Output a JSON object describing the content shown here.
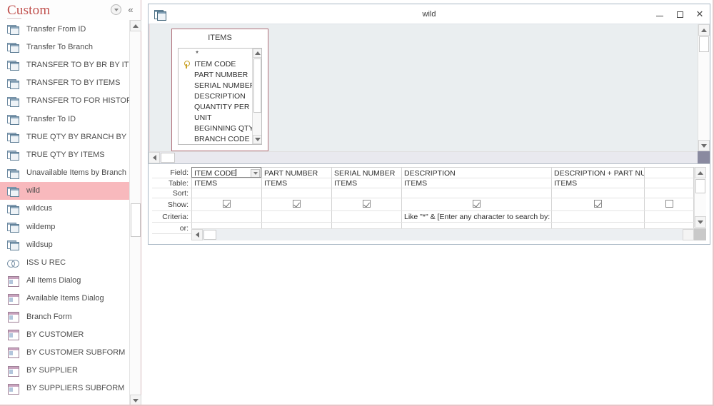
{
  "nav_pane": {
    "title": "Custom",
    "dropdown_icon": "chevron-down-circle-icon",
    "collapse_icon": "double-chevron-left-icon",
    "items": [
      {
        "label": "Transfer From ID",
        "icon": "query-icon",
        "type": "query",
        "selected": false
      },
      {
        "label": "Transfer To Branch",
        "icon": "query-icon",
        "type": "query",
        "selected": false
      },
      {
        "label": "TRANSFER TO BY BR BY ITEMS",
        "icon": "query-icon",
        "type": "query",
        "selected": false
      },
      {
        "label": "TRANSFER TO BY ITEMS",
        "icon": "query-icon",
        "type": "query",
        "selected": false
      },
      {
        "label": "TRANSFER TO FOR HISTORY",
        "icon": "query-icon",
        "type": "query",
        "selected": false
      },
      {
        "label": "Transfer To ID",
        "icon": "query-icon",
        "type": "query",
        "selected": false
      },
      {
        "label": "TRUE QTY BY BRANCH BY ITEM",
        "icon": "query-icon",
        "type": "query",
        "selected": false
      },
      {
        "label": "TRUE QTY BY ITEMS",
        "icon": "query-icon",
        "type": "query",
        "selected": false
      },
      {
        "label": "Unavailable Items by Branch",
        "icon": "query-icon",
        "type": "query",
        "selected": false
      },
      {
        "label": "wild",
        "icon": "query-icon",
        "type": "query",
        "selected": true
      },
      {
        "label": "wildcus",
        "icon": "query-icon",
        "type": "query",
        "selected": false
      },
      {
        "label": "wildemp",
        "icon": "query-icon",
        "type": "query",
        "selected": false
      },
      {
        "label": "wildsup",
        "icon": "query-icon",
        "type": "query",
        "selected": false
      },
      {
        "label": "ISS U REC",
        "icon": "macro-icon",
        "type": "macro",
        "selected": false
      },
      {
        "label": "All Items Dialog",
        "icon": "form-icon",
        "type": "form",
        "selected": false
      },
      {
        "label": "Available Items Dialog",
        "icon": "form-icon",
        "type": "form",
        "selected": false
      },
      {
        "label": "Branch Form",
        "icon": "form-icon",
        "type": "form",
        "selected": false
      },
      {
        "label": "BY CUSTOMER",
        "icon": "form-icon",
        "type": "form",
        "selected": false
      },
      {
        "label": "BY CUSTOMER SUBFORM",
        "icon": "form-icon",
        "type": "form",
        "selected": false
      },
      {
        "label": "BY SUPPLIER",
        "icon": "form-icon",
        "type": "form",
        "selected": false
      },
      {
        "label": "BY SUPPLIERS SUBFORM",
        "icon": "form-icon",
        "type": "form",
        "selected": false
      }
    ],
    "scrollbar": {
      "up_icon": "scroll-up-arrow-icon",
      "down_icon": "scroll-down-arrow-icon"
    }
  },
  "document_window": {
    "title": "wild",
    "icon": "query-design-icon",
    "minimize_label": "–",
    "maximize_label": "□",
    "close_label": "✕"
  },
  "diagram": {
    "table_box": {
      "title": "ITEMS",
      "fields": [
        {
          "name": "*",
          "key": false
        },
        {
          "name": "ITEM CODE",
          "key": true
        },
        {
          "name": "PART NUMBER",
          "key": false
        },
        {
          "name": "SERIAL NUMBER",
          "key": false
        },
        {
          "name": "DESCRIPTION",
          "key": false
        },
        {
          "name": "QUANTITY PER UNIT",
          "key": false
        },
        {
          "name": "UNIT",
          "key": false
        },
        {
          "name": "BEGINNING QTY",
          "key": false
        },
        {
          "name": "BRANCH CODE",
          "key": false
        }
      ]
    }
  },
  "query_grid": {
    "row_labels": {
      "field": "Field:",
      "table": "Table:",
      "sort": "Sort:",
      "show": "Show:",
      "criteria": "Criteria:",
      "or": "or:"
    },
    "columns": [
      {
        "field": "ITEM CODE",
        "table": "ITEMS",
        "sort": "",
        "show": true,
        "criteria": "",
        "or": "",
        "active": true,
        "has_dropdown": true
      },
      {
        "field": "PART NUMBER",
        "table": "ITEMS",
        "sort": "",
        "show": true,
        "criteria": "",
        "or": "",
        "active": false,
        "has_dropdown": false
      },
      {
        "field": "SERIAL NUMBER",
        "table": "ITEMS",
        "sort": "",
        "show": true,
        "criteria": "",
        "or": "",
        "active": false,
        "has_dropdown": false
      },
      {
        "field": "DESCRIPTION",
        "table": "ITEMS",
        "sort": "",
        "show": true,
        "criteria": "Like \"*\" & [Enter any character to search by: ] & \"*\"",
        "or": "",
        "active": false,
        "has_dropdown": false
      },
      {
        "field": "DESCRIPTION + PART NUMBER",
        "table": "ITEMS",
        "sort": "",
        "show": true,
        "criteria": "",
        "or": "",
        "active": false,
        "has_dropdown": false
      },
      {
        "field": "",
        "table": "",
        "sort": "",
        "show": false,
        "criteria": "",
        "or": "",
        "active": false,
        "has_dropdown": false
      }
    ]
  },
  "colors": {
    "accent": "#c0504d",
    "selection": "#f8b9bd",
    "pane_background": "#eaeef0",
    "table_box_border": "#b0707a",
    "nav_border": "#d8b9bd"
  }
}
